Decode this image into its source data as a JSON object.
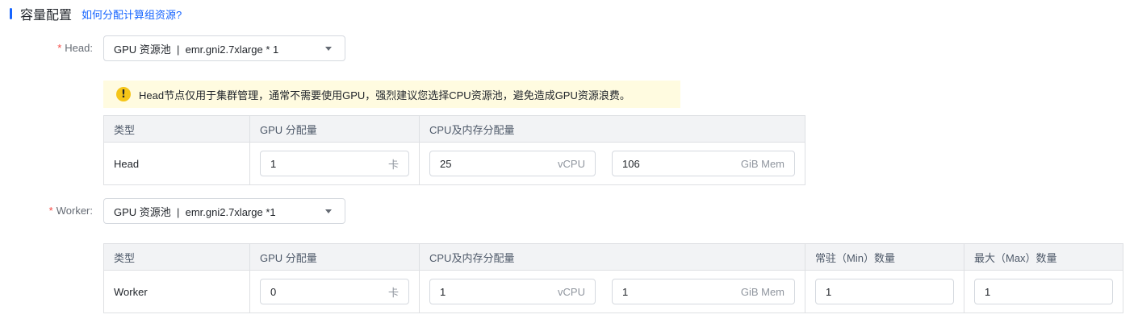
{
  "header": {
    "title": "容量配置",
    "help_link": "如何分配计算组资源?"
  },
  "head": {
    "label": "Head",
    "select_value": "GPU 资源池  |  emr.gni2.7xlarge * 1",
    "alert": "Head节点仅用于集群管理，通常不需要使用GPU，强烈建议您选择CPU资源池，避免造成GPU资源浪费。",
    "alert_icon": "!",
    "table": {
      "columns": [
        "类型",
        "GPU 分配量",
        "CPU及内存分配量"
      ],
      "row": {
        "type": "Head",
        "gpu": "1",
        "gpu_unit": "卡",
        "vcpu": "25",
        "vcpu_unit": "vCPU",
        "mem": "106",
        "mem_unit": "GiB Mem"
      }
    }
  },
  "worker": {
    "label": "Worker",
    "select_value": "GPU 资源池  |  emr.gni2.7xlarge *1",
    "table": {
      "columns": [
        "类型",
        "GPU 分配量",
        "CPU及内存分配量",
        "常驻（Min）数量",
        "最大（Max）数量"
      ],
      "row": {
        "type": "Worker",
        "gpu": "0",
        "gpu_unit": "卡",
        "vcpu": "1",
        "vcpu_unit": "vCPU",
        "mem": "1",
        "mem_unit": "GiB Mem",
        "min": "1",
        "max": "1"
      }
    }
  },
  "form": {
    "required_mark": "*",
    "colon": ":"
  },
  "colors": {
    "accent": "#1664ff",
    "required": "#f54a45",
    "warning_bg": "#fffbe0",
    "warning_icon": "#f5c518",
    "table_header_bg": "#f2f3f5"
  }
}
